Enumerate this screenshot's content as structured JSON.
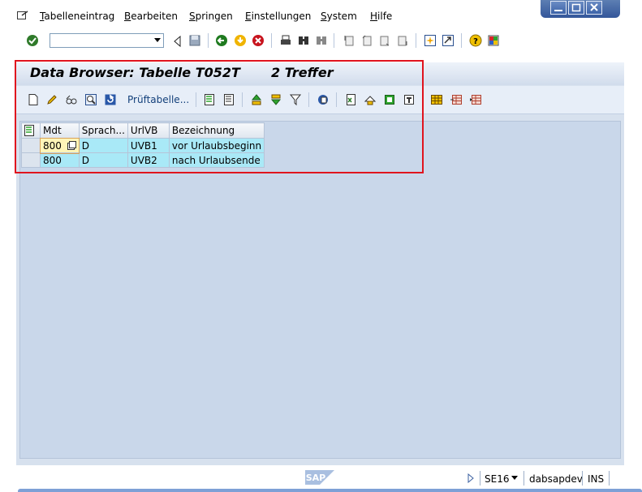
{
  "menubar": {
    "items": [
      {
        "label": "Tabelleneintrag",
        "mnemonic": "T",
        "rest": "abelleneintrag"
      },
      {
        "label": "Bearbeiten",
        "mnemonic": "B",
        "rest": "earbeiten"
      },
      {
        "label": "Springen",
        "mnemonic": "S",
        "rest": "pringen"
      },
      {
        "label": "Einstellungen",
        "mnemonic": "E",
        "rest": "instellungen"
      },
      {
        "label": "System",
        "mnemonic": "S",
        "rest": "ystem"
      },
      {
        "label": "Hilfe",
        "mnemonic": "H",
        "rest": "ilfe"
      }
    ]
  },
  "command_field": {
    "value": ""
  },
  "screen": {
    "title": "Data Browser: Tabelle T052T",
    "hits": "2 Treffer",
    "check_table_button": "Prüftabelle..."
  },
  "table": {
    "columns": [
      "Mdt",
      "Sprach...",
      "UrlVB",
      "Bezeichnung"
    ],
    "rows": [
      {
        "mdt": "800",
        "sprache": "D",
        "urlvb": "UVB1",
        "bezeichnung": "vor Urlaubsbeginn"
      },
      {
        "mdt": "800",
        "sprache": "D",
        "urlvb": "UVB2",
        "bezeichnung": "nach Urlaubsende"
      }
    ]
  },
  "status": {
    "logo": "SAP",
    "transaction": "SE16",
    "server": "dabsapdev",
    "mode": "INS"
  },
  "colors": {
    "highlight": "#e0141e",
    "key_cell": "#a9e9f7",
    "background": "#c9d7ea"
  }
}
